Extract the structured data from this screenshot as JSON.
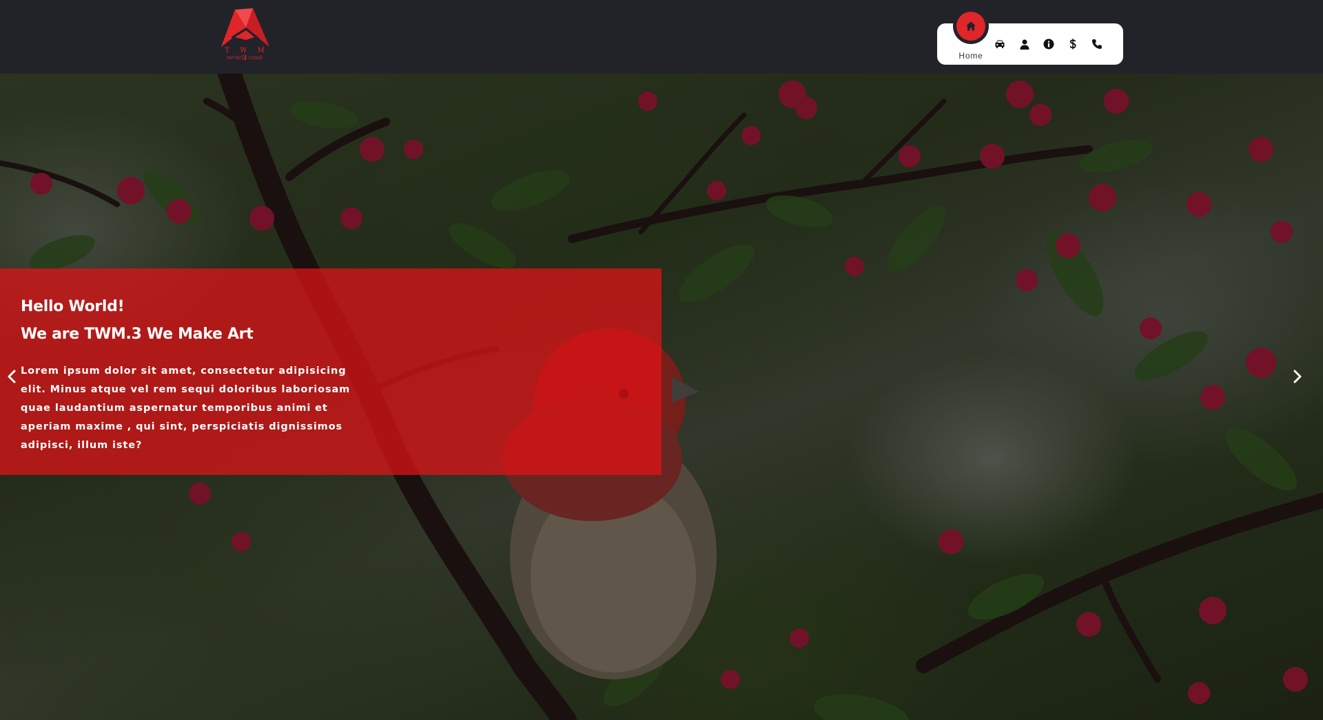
{
  "brand": {
    "logo_text": "T W M 3",
    "logo_tagline": "INFINITE CODE"
  },
  "nav": {
    "active": {
      "label": "Home",
      "icon": "home-icon"
    },
    "items": [
      {
        "icon": "car-icon"
      },
      {
        "icon": "user-icon"
      },
      {
        "icon": "info-icon"
      },
      {
        "icon": "dollar-icon"
      },
      {
        "icon": "phone-icon"
      }
    ]
  },
  "hero": {
    "title_line1": "Hello World!",
    "title_line2": "We are TWM.3 We Make Art",
    "text": "Lorem ipsum dolor sit amet, consectetur adipisicing elit. Minus atque vel rem sequi doloribus laboriosam quae laudantium aspernatur temporibus animi et aperiam maxime , qui sint, perspiciatis dignissimos adipisci, illum iste?",
    "prev_icon": "chevron-left-icon",
    "next_icon": "chevron-right-icon"
  },
  "colors": {
    "header_bg": "#222328",
    "accent": "#e0262b",
    "nav_bg": "#ffffff",
    "overlay": "#e41216"
  }
}
